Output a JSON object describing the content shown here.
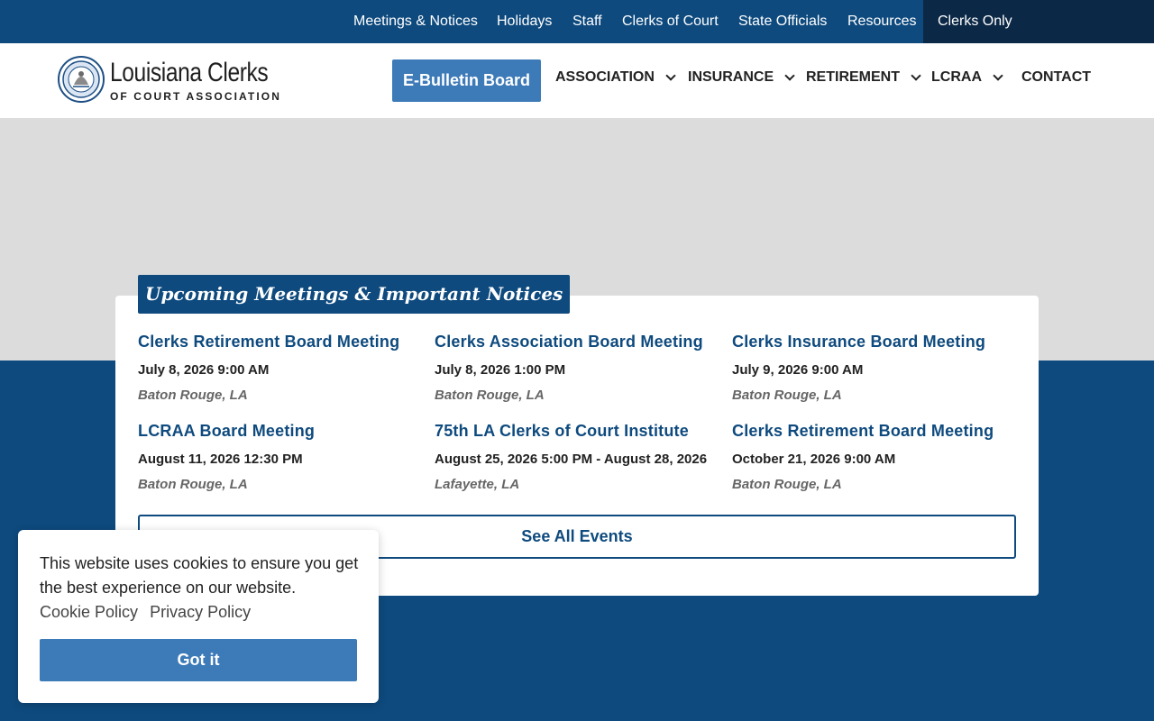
{
  "topbar": {
    "links": [
      "Meetings & Notices",
      "Holidays",
      "Staff",
      "Clerks of Court",
      "State Officials",
      "Resources"
    ],
    "clerks_only": "Clerks Only"
  },
  "header": {
    "logo_name": "Louisiana Clerks",
    "logo_sub": "OF COURT ASSOCIATION",
    "ebulletin": "E-Bulletin Board",
    "nav": [
      "ASSOCIATION",
      "INSURANCE",
      "RETIREMENT",
      "LCRAA",
      "CONTACT"
    ]
  },
  "events": {
    "heading": "Upcoming Meetings & Important Notices",
    "items": [
      {
        "title": "Clerks Retirement Board Meeting",
        "date": "July 8, 2026 9:00 AM",
        "location": "Baton Rouge, LA"
      },
      {
        "title": "Clerks Association Board Meeting",
        "date": "July 8, 2026 1:00 PM",
        "location": "Baton Rouge, LA"
      },
      {
        "title": "Clerks Insurance Board Meeting",
        "date": "July 9, 2026 9:00 AM",
        "location": "Baton Rouge, LA"
      },
      {
        "title": "LCRAA Board Meeting",
        "date": "August 11, 2026 12:30 PM",
        "location": "Baton Rouge, LA"
      },
      {
        "title": "75th LA Clerks of Court Institute",
        "date": "August 25, 2026 5:00 PM - August 28, 2026",
        "location": "Lafayette, LA"
      },
      {
        "title": "Clerks Retirement Board Meeting",
        "date": "October 21, 2026 9:00 AM",
        "location": "Baton Rouge, LA"
      }
    ],
    "see_all": "See All Events"
  },
  "cookie": {
    "message": "This website uses cookies to ensure you get the best experience on our website.",
    "cookie_policy": "Cookie Policy",
    "privacy_policy": "Privacy Policy",
    "accept": "Got it"
  },
  "colors": {
    "primary": "#0e4a7e",
    "button": "#3d7ab8",
    "dark": "#0b2846",
    "hero": "#dcdcdc"
  }
}
